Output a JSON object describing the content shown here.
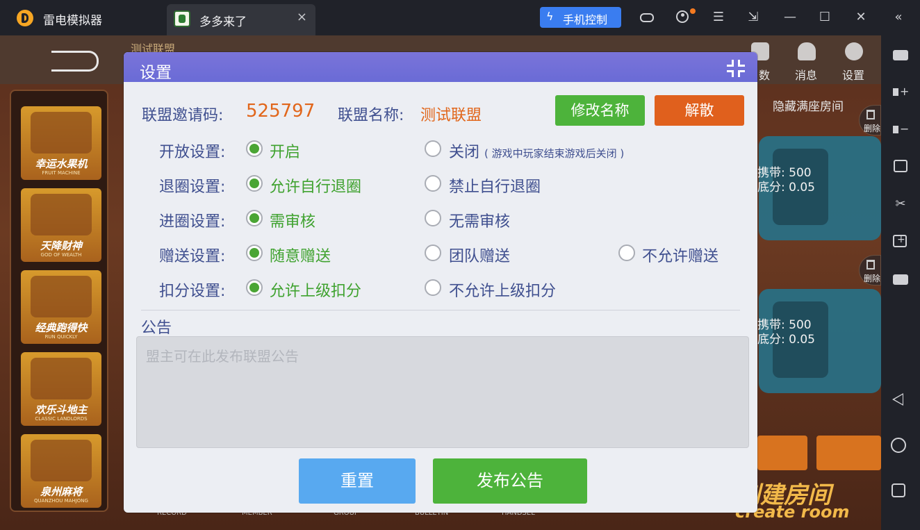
{
  "emulator": {
    "app_title": "雷电模拟器",
    "tab_title": "多多来了",
    "phone_control": "手机控制",
    "accent": "#3a7df0"
  },
  "game_bg": {
    "faint_title": "测试联盟",
    "top_icons": [
      {
        "label": "数"
      },
      {
        "label": "消息"
      },
      {
        "label": "设置"
      }
    ],
    "hide_full_rooms": "隐藏满座房间",
    "games": [
      {
        "cn": "幸运水果机",
        "en": "FRUIT MACHINE"
      },
      {
        "cn": "天降财神",
        "en": "GOD OF WEALTH"
      },
      {
        "cn": "经典跑得快",
        "en": "RUN QUICKLY"
      },
      {
        "cn": "欢乐斗地主",
        "en": "CLASSIC LANDLORDS"
      },
      {
        "cn": "泉州麻将",
        "en": "QUANZHOU MAHJONG"
      }
    ],
    "rooms": [
      {
        "carry": "携带: 500",
        "base": "底分: 0.05"
      },
      {
        "carry": "携带: 500",
        "base": "底分: 0.05"
      }
    ],
    "delete_label": "删除",
    "bottom_nav": [
      "RECORD",
      "MEMBER",
      "GROUP",
      "BULLETIN",
      "HANDSEL"
    ],
    "create_room_cn": "创建房间",
    "create_room_en": "create room"
  },
  "modal": {
    "title": "设置",
    "invite_label": "联盟邀请码:",
    "invite_code": "525797",
    "name_label": "联盟名称:",
    "name_value": "测试联盟",
    "rename_button": "修改名称",
    "dissolve_button": "解散",
    "settings": [
      {
        "label": "开放设置:",
        "options": [
          {
            "text": "开启",
            "checked": true
          },
          {
            "text": "关闭",
            "note": "( 游戏中玩家结束游戏后关闭 )",
            "checked": false
          }
        ]
      },
      {
        "label": "退圈设置:",
        "options": [
          {
            "text": "允许自行退圈",
            "checked": true
          },
          {
            "text": "禁止自行退圈",
            "checked": false
          }
        ]
      },
      {
        "label": "进圈设置:",
        "options": [
          {
            "text": "需审核",
            "checked": true
          },
          {
            "text": "无需审核",
            "checked": false
          }
        ]
      },
      {
        "label": "赠送设置:",
        "options": [
          {
            "text": "随意赠送",
            "checked": true
          },
          {
            "text": "团队赠送",
            "checked": false
          },
          {
            "text": "不允许赠送",
            "checked": false
          }
        ]
      },
      {
        "label": "扣分设置:",
        "options": [
          {
            "text": "允许上级扣分",
            "checked": true
          },
          {
            "text": "不允许上级扣分",
            "checked": false
          }
        ]
      }
    ],
    "notice_label": "公告",
    "notice_placeholder": "盟主可在此发布联盟公告",
    "notice_value": "",
    "reset_button": "重置",
    "publish_button": "发布公告",
    "colors": {
      "header": "#6a6bd6",
      "green": "#4db33b",
      "orange": "#e0601d",
      "blue": "#58a9f0"
    }
  }
}
